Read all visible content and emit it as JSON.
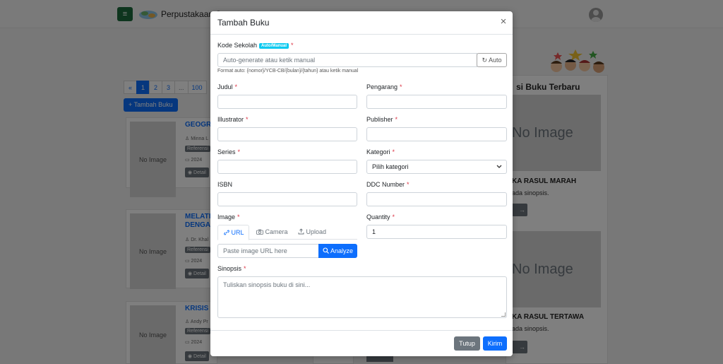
{
  "app": {
    "brand": "Perpustakaan S",
    "menu_icon": "≡"
  },
  "pager": {
    "items": [
      "«",
      "1",
      "2",
      "3",
      "...",
      "100"
    ],
    "active": "1"
  },
  "add_book_button": "+ Tambah Buku",
  "books": [
    {
      "title": "GEOGRA",
      "author": "♙ Minna L",
      "badge": "Referensi",
      "year": "▭ 2024",
      "detail": "◉ Detail",
      "image": "No Image"
    },
    {
      "title": "MELATI\nDENGAN",
      "author": "♙ Dr. Khal",
      "badge": "Referensi",
      "year": "▭ 2024",
      "detail": "◉ Detail",
      "image": "No Image"
    },
    {
      "title": "KRISIS I",
      "author": "♙ Andy Pr",
      "badge": "Referensi",
      "year": "▭ 2024",
      "detail": "◉ Detail",
      "image": "No Image"
    }
  ],
  "sidebar": {
    "title": "si Buku Terbaru",
    "items": [
      {
        "image": "No Image",
        "name": "KA RASUL MARAH",
        "synopsis": "ada sinopsis.",
        "button": "→"
      },
      {
        "image": "No Image",
        "name": "KA RASUL TERTAWA",
        "synopsis": "ada sinopsis.",
        "button": "→"
      }
    ]
  },
  "modal": {
    "title": "Tambah Buku",
    "close_icon": "×",
    "kode_sekolah": {
      "label": "Kode Sekolah",
      "tag": "Auto/Manual",
      "required": "*",
      "placeholder": "Auto-generate atau ketik manual",
      "auto_button": "↻ Auto",
      "hint": "Format auto: {nomor}/YCB-CB/{bulan}/{tahun} atau ketik manual"
    },
    "fields": {
      "judul": {
        "label": "Judul",
        "required": "*"
      },
      "pengarang": {
        "label": "Pengarang",
        "required": "*"
      },
      "illustrator": {
        "label": "Illustrator",
        "required": "*"
      },
      "publisher": {
        "label": "Publisher",
        "required": "*"
      },
      "series": {
        "label": "Series",
        "required": "*"
      },
      "kategori": {
        "label": "Kategori",
        "required": "*",
        "selected": "Pilih kategori"
      },
      "isbn": {
        "label": "ISBN"
      },
      "ddc": {
        "label": "DDC Number",
        "required": "*"
      },
      "image": {
        "label": "Image",
        "required": "*"
      },
      "quantity": {
        "label": "Quantity",
        "required": "*",
        "value": "1"
      },
      "sinopsis": {
        "label": "Sinopsis",
        "required": "*",
        "placeholder": "Tuliskan sinopsis buku di sini..."
      }
    },
    "image_tabs": [
      {
        "label": "URL",
        "icon": "link-icon"
      },
      {
        "label": "Camera",
        "icon": "camera-icon"
      },
      {
        "label": "Upload",
        "icon": "upload-icon"
      }
    ],
    "url_placeholder": "Paste image URL here",
    "analyze_button": "Analyze",
    "footer": {
      "close": "Tutup",
      "submit": "Kirim"
    }
  }
}
